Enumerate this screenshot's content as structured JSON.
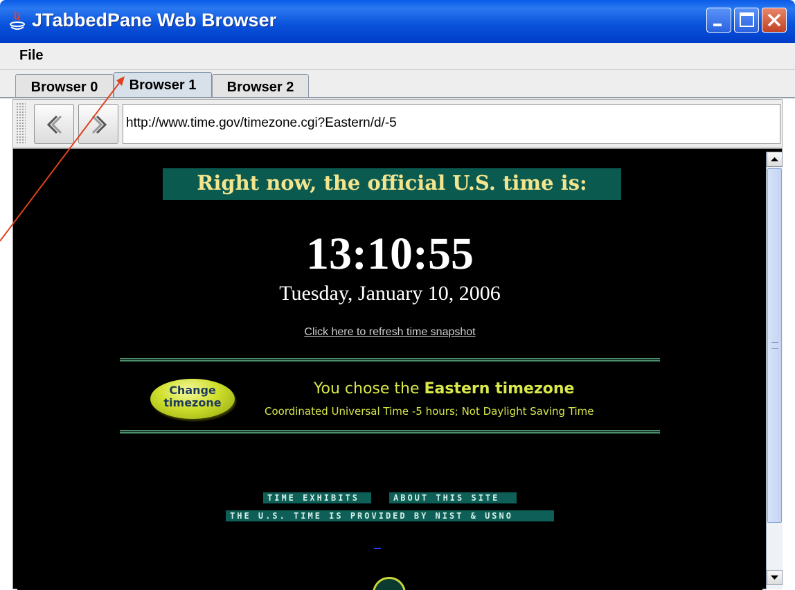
{
  "window": {
    "title": "JTabbedPane Web Browser",
    "icons": [
      "java-icon",
      "minimize-icon",
      "maximize-icon",
      "close-icon"
    ],
    "colors": {
      "titlebar": "#0b54dc",
      "close_button": "#c24224"
    }
  },
  "menu": {
    "file_label": "File"
  },
  "tabs": [
    {
      "label": "Browser 0"
    },
    {
      "label": "Browser 1",
      "active": true
    },
    {
      "label": "Browser 2"
    }
  ],
  "toolbar": {
    "back_icon": "chevron-left-icon",
    "forward_icon": "chevron-right-icon",
    "url": "http://www.time.gov/timezone.cgi?Eastern/d/-5"
  },
  "page": {
    "headline": "Right now, the official U.S. time is:",
    "clock": "13:10:55",
    "date": "Tuesday, January 10, 2006",
    "refresh_link": "Click here to refresh time snapshot",
    "change_button": {
      "line1": "Change",
      "line2": "timezone"
    },
    "tz_prefix": "You chose the ",
    "tz_name": "Eastern timezone",
    "tz_detail": "Coordinated Universal Time -5 hours; Not Daylight Saving Time",
    "link_time_exhibits": "TIME EXHIBITS",
    "link_about": "ABOUT THIS SITE",
    "provided_by": "THE U.S. TIME IS PROVIDED BY NIST & USNO",
    "colors": {
      "background": "#000000",
      "headline_bg": "#0b5a50",
      "headline_text": "#f3e58e",
      "accent": "#d9e84a"
    }
  },
  "annotation": {
    "arrow_color": "#e0401c"
  }
}
